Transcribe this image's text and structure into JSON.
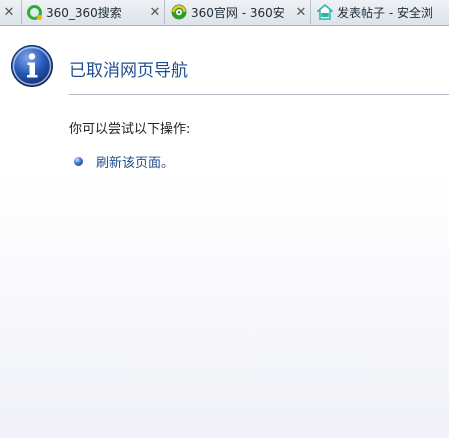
{
  "tabs": [
    {
      "title": "360_360搜索",
      "favicon": "360-search-icon"
    },
    {
      "title": "360官网 - 360安",
      "favicon": "360-logo-icon"
    },
    {
      "title": "发表帖子 - 安全浏",
      "favicon": "360-safe-icon"
    }
  ],
  "tab_close_glyph": "✕",
  "page": {
    "heading": "已取消网页导航",
    "prompt": "你可以尝试以下操作:",
    "action": "刷新该页面。"
  },
  "colors": {
    "heading": "#1f4e8c",
    "link": "#1f4e8c",
    "info_icon": "#2356b3"
  }
}
